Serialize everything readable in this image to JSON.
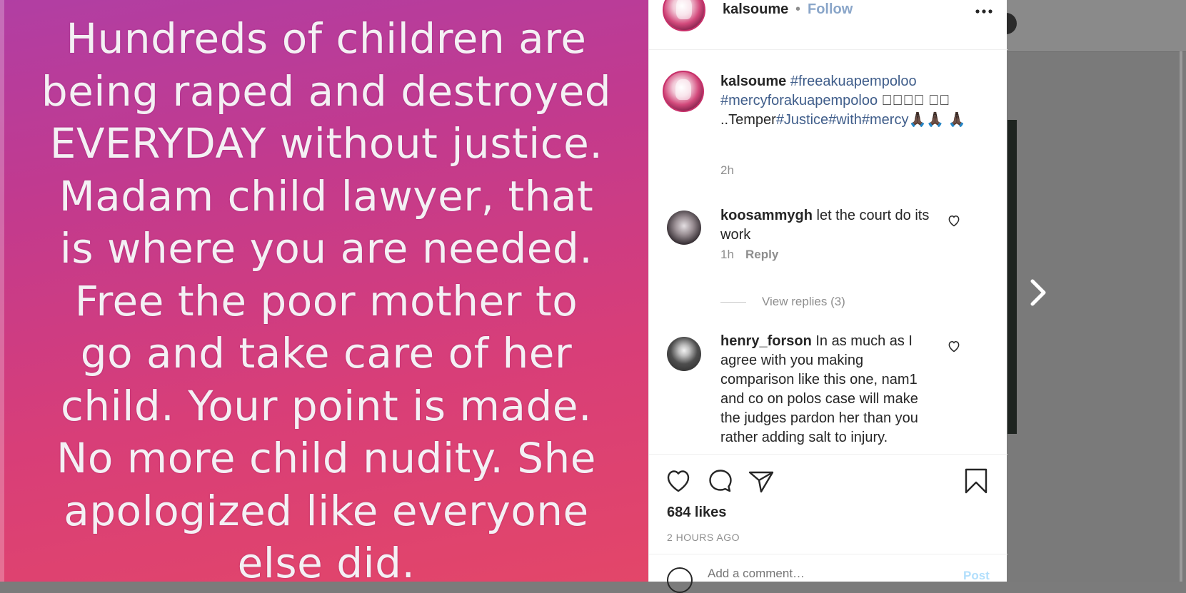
{
  "post": {
    "image_text": "Hundreds of children are\nbeing raped and destroyed\nEVERYDAY without justice.\nMadam child lawyer, that\nis where you are needed.\nFree the poor mother to\ngo and take care of her\nchild. Your point is made.\nNo more child nudity. She\napologized like everyone\nelse did.",
    "author": "kalsoume",
    "follow_dot": "•",
    "follow_label": "Follow"
  },
  "caption": {
    "username": "kalsoume",
    "hashtag1": "#freeakuapempoloo",
    "hashtag2": "#mercyforakuapempoloo",
    "boxes1": "🏻🏻🏻🏻",
    "boxes2": "🏻🏻",
    "text_mid": "..Temper",
    "hashtag3": "#Justice",
    "hashtag4": "#with",
    "hashtag5": "#mercy",
    "emoji": "🙏🏿🙏🏿",
    "emoji2": "🙏🏿",
    "time": "2h"
  },
  "comments": [
    {
      "username": "koosammygh",
      "text": "let the court do its work",
      "time": "1h",
      "reply_label": "Reply",
      "view_replies": "View replies (3)"
    },
    {
      "username": "henry_forson",
      "text": "In as much as I agree with you making comparison like this one, nam1 and co on polos case will make the judges pardon her than you rather adding salt to injury."
    }
  ],
  "actions": {
    "likes": "684 likes",
    "timestamp": "2 HOURS AGO"
  },
  "add_comment": {
    "placeholder": "Add a comment…",
    "post_label": "Post"
  },
  "colors": {
    "follow": "#8aa6c9",
    "hashtag": "#3f5d8a",
    "image_gradient_top": "#b13ea3",
    "image_gradient_bottom": "#e34669"
  }
}
